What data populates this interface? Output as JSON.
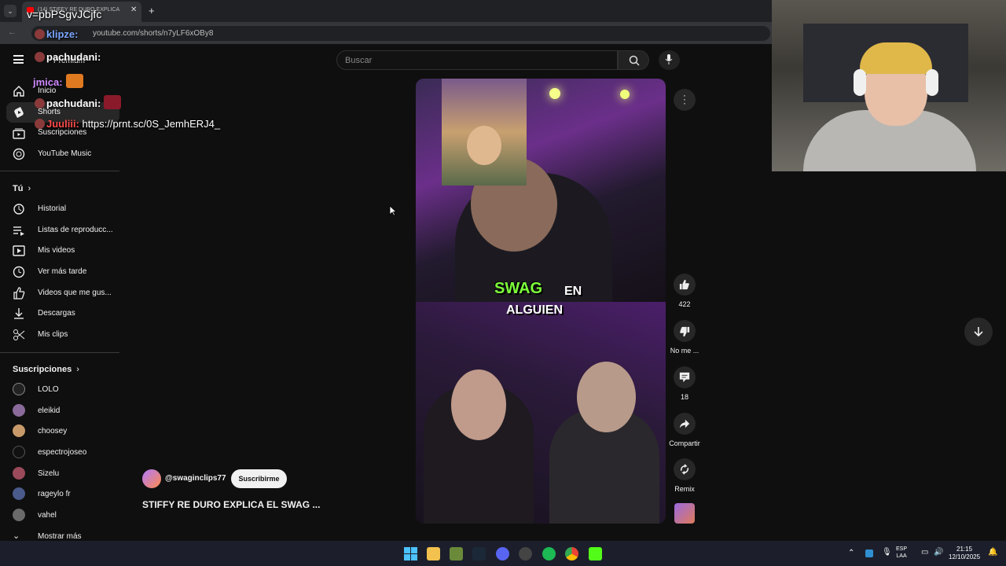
{
  "browser": {
    "tab_title": "(14) STIFFY RE DURO EXPLICA",
    "url": "youtube.com/shorts/n7yLF6xOBy8",
    "add_tab": "+"
  },
  "search": {
    "placeholder": "Buscar"
  },
  "sidebar": {
    "premium_label": "Premium",
    "main": [
      {
        "label": "Inicio",
        "icon": "home-icon"
      },
      {
        "label": "Shorts",
        "icon": "shorts-icon"
      },
      {
        "label": "Suscripciones",
        "icon": "subscriptions-icon"
      },
      {
        "label": "YouTube Music",
        "icon": "music-icon"
      }
    ],
    "you_section": "Tú",
    "you_items": [
      {
        "label": "Historial",
        "icon": "history-icon"
      },
      {
        "label": "Listas de reproducc...",
        "icon": "playlists-icon"
      },
      {
        "label": "Mis videos",
        "icon": "my-videos-icon"
      },
      {
        "label": "Ver más tarde",
        "icon": "watch-later-icon"
      },
      {
        "label": "Videos que me gus...",
        "icon": "like-icon"
      },
      {
        "label": "Descargas",
        "icon": "download-icon"
      },
      {
        "label": "Mis clips",
        "icon": "scissors-icon"
      }
    ],
    "subs_section": "Suscripciones",
    "subs": [
      {
        "label": "LOLO",
        "color": "#222222"
      },
      {
        "label": "eleikid",
        "color": "#8a6a9a"
      },
      {
        "label": "choosey",
        "color": "#c89a6a"
      },
      {
        "label": "espectrojoseo",
        "color": "#111111"
      },
      {
        "label": "Sizelu",
        "color": "#9a4a5a"
      },
      {
        "label": "rageylo fr",
        "color": "#4a5a8a"
      },
      {
        "label": "vahel",
        "color": "#6a6a6a"
      }
    ],
    "show_more": "Mostrar más"
  },
  "video": {
    "caption_word1": "SWAG",
    "caption_word2": "EN",
    "caption_line2": "ALGUIEN",
    "channel": "@swaginclips77",
    "subscribe": "Suscribirme",
    "title": "STIFFY RE DURO EXPLICA EL SWAG ..."
  },
  "actions": {
    "likes": "422",
    "dislike": "No me ...",
    "comments": "18",
    "share": "Compartir",
    "remix": "Remix"
  },
  "chat": [
    {
      "user": "v=pbPSgvJCjfc",
      "msg": ""
    },
    {
      "user": "klipze:",
      "msg": ""
    },
    {
      "user": "pachudani:",
      "msg": ""
    },
    {
      "user": "jmica:",
      "msg": ""
    },
    {
      "user": "pachudani:",
      "msg": ""
    },
    {
      "user": "Juuliii:",
      "msg": "https://prnt.sc/0S_JemhERJ4_"
    }
  ],
  "taskbar": {
    "lang": "ESP",
    "layout": "LAA",
    "time": "21:15",
    "date": "12/10/2025"
  }
}
